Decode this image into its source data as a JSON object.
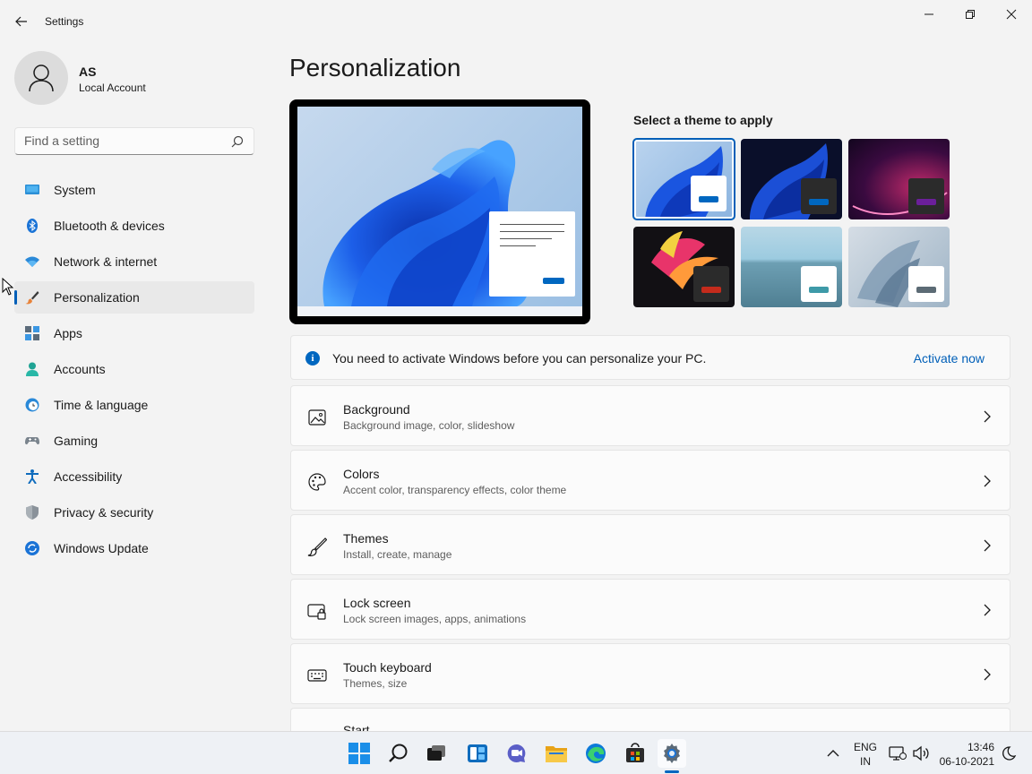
{
  "window": {
    "title": "Settings",
    "controls": {
      "minimize": "minimize",
      "maximize": "restore",
      "close": "close"
    }
  },
  "profile": {
    "name": "AS",
    "account_type": "Local Account"
  },
  "search": {
    "placeholder": "Find a setting",
    "value": ""
  },
  "sidebar": {
    "items": [
      {
        "label": "System",
        "icon": "system-icon",
        "active": false
      },
      {
        "label": "Bluetooth & devices",
        "icon": "bluetooth-icon",
        "active": false
      },
      {
        "label": "Network & internet",
        "icon": "wifi-icon",
        "active": false
      },
      {
        "label": "Personalization",
        "icon": "brush-icon",
        "active": true
      },
      {
        "label": "Apps",
        "icon": "apps-icon",
        "active": false
      },
      {
        "label": "Accounts",
        "icon": "accounts-icon",
        "active": false
      },
      {
        "label": "Time & language",
        "icon": "clock-globe-icon",
        "active": false
      },
      {
        "label": "Gaming",
        "icon": "gamepad-icon",
        "active": false
      },
      {
        "label": "Accessibility",
        "icon": "accessibility-icon",
        "active": false
      },
      {
        "label": "Privacy & security",
        "icon": "shield-icon",
        "active": false
      },
      {
        "label": "Windows Update",
        "icon": "update-icon",
        "active": false
      }
    ]
  },
  "main": {
    "title": "Personalization",
    "theme_label": "Select a theme to apply",
    "themes": [
      {
        "name": "windows-light",
        "selected": true,
        "accent": "#0067c0"
      },
      {
        "name": "windows-dark",
        "selected": false,
        "accent": "#0067c0"
      },
      {
        "name": "glow",
        "selected": false,
        "accent": "#6b1f9a"
      },
      {
        "name": "captured-motion",
        "selected": false,
        "accent": "#c42b1c"
      },
      {
        "name": "sunrise",
        "selected": false,
        "accent": "#3e9aa8"
      },
      {
        "name": "flow",
        "selected": false,
        "accent": "#5c6b75"
      }
    ],
    "banner": {
      "text": "You need to activate Windows before you can personalize your PC.",
      "link": "Activate now"
    },
    "cards": [
      {
        "title": "Background",
        "subtitle": "Background image, color, slideshow",
        "icon": "image-icon"
      },
      {
        "title": "Colors",
        "subtitle": "Accent color, transparency effects, color theme",
        "icon": "palette-icon"
      },
      {
        "title": "Themes",
        "subtitle": "Install, create, manage",
        "icon": "brush-icon"
      },
      {
        "title": "Lock screen",
        "subtitle": "Lock screen images, apps, animations",
        "icon": "lock-screen-icon"
      },
      {
        "title": "Touch keyboard",
        "subtitle": "Themes, size",
        "icon": "keyboard-icon"
      },
      {
        "title": "Start",
        "subtitle": "",
        "icon": "start-icon"
      }
    ]
  },
  "taskbar": {
    "apps": [
      "start-icon",
      "search-icon",
      "task-view-icon",
      "widgets-icon",
      "chat-icon",
      "file-explorer-icon",
      "edge-icon",
      "store-icon",
      "settings-icon"
    ],
    "lang_line1": "ENG",
    "lang_line2": "IN",
    "time": "13:46",
    "date": "06-10-2021"
  },
  "colors": {
    "accent": "#005fb8",
    "window_bg": "#f3f3f3",
    "card_bg": "#fbfbfb"
  }
}
